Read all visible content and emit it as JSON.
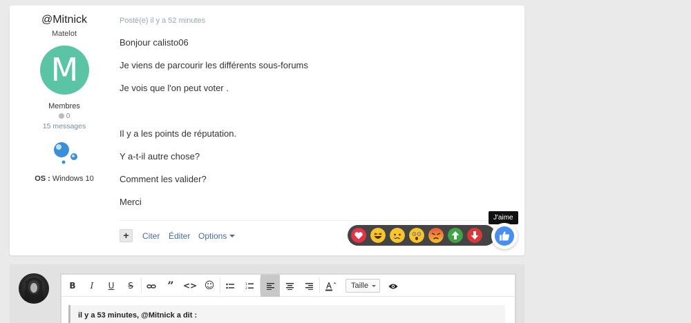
{
  "post": {
    "author": {
      "name": "@Mitnick",
      "title": "Matelot",
      "avatar_letter": "M",
      "avatar_color": "#5ac4a5",
      "group": "Membres",
      "reputation": "0",
      "message_count": "15 messages",
      "os_label": "OS :",
      "os_value": "Windows 10"
    },
    "meta": "Posté(e) il y a 52 minutes",
    "body": [
      "Bonjour calisto06",
      "Je viens de parcourir les différents sous-forums",
      "Je vois que l'on peut voter  .",
      "Il y a les points de réputation.",
      "Y a-t-il autre chose?",
      "Comment les valider?",
      "Merci"
    ],
    "actions": {
      "plus": "+",
      "quote": "Citer",
      "edit": "Éditer",
      "options": "Options"
    },
    "reactions": {
      "tooltip": "J'aime",
      "items": [
        "heart-icon",
        "laugh-icon",
        "sad-icon",
        "wow-icon",
        "angry-icon",
        "upvote-icon",
        "downvote-icon"
      ],
      "like_icon": "thumbs-up-icon",
      "like_color": "#4a8ef2"
    }
  },
  "reply": {
    "toolbar": {
      "bold": "B",
      "italic": "I",
      "underline": "U",
      "strike": "S",
      "size_label": "Taille"
    },
    "quote_header": "il y a 53 minutes, @Mitnick a dit :"
  }
}
